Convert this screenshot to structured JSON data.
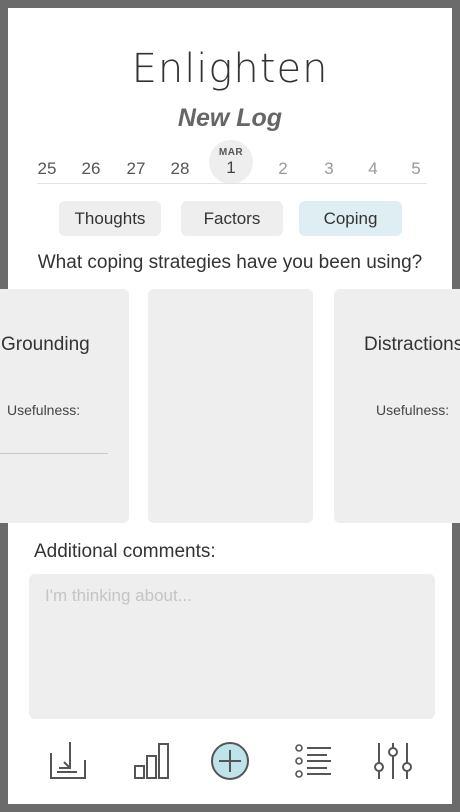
{
  "app": {
    "title": "Enlighten",
    "subtitle": "New Log"
  },
  "dates": [
    {
      "day": "25",
      "month": "",
      "state": "normal"
    },
    {
      "day": "26",
      "month": "",
      "state": "normal"
    },
    {
      "day": "27",
      "month": "",
      "state": "normal"
    },
    {
      "day": "28",
      "month": "",
      "state": "normal"
    },
    {
      "day": "1",
      "month": "MAR",
      "state": "selected"
    },
    {
      "day": "2",
      "month": "",
      "state": "muted"
    },
    {
      "day": "3",
      "month": "",
      "state": "muted"
    },
    {
      "day": "4",
      "month": "",
      "state": "muted"
    },
    {
      "day": "5",
      "month": "",
      "state": "muted"
    }
  ],
  "tabs": [
    {
      "label": "Thoughts",
      "active": false
    },
    {
      "label": "Factors",
      "active": false
    },
    {
      "label": "Coping",
      "active": true
    }
  ],
  "question": "What coping strategies have you been using?",
  "cards": [
    {
      "title": "Grounding",
      "usefulness_label": "Usefulness:"
    },
    {
      "title": "",
      "usefulness_label": ""
    },
    {
      "title": "Distractions",
      "usefulness_label": "Usefulness:"
    }
  ],
  "comments": {
    "label": "Additional comments:",
    "placeholder": "I'm thinking about..."
  },
  "nav": {
    "items": [
      {
        "icon": "download-tray-icon"
      },
      {
        "icon": "bar-chart-icon"
      },
      {
        "icon": "add-circle-icon",
        "active": true
      },
      {
        "icon": "list-icon"
      },
      {
        "icon": "sliders-icon"
      }
    ]
  },
  "colors": {
    "active_tab": "#dfeef3",
    "accent_teal": "#bfe3ea",
    "card_bg": "#eeeeee",
    "icon_stroke": "#555555"
  }
}
